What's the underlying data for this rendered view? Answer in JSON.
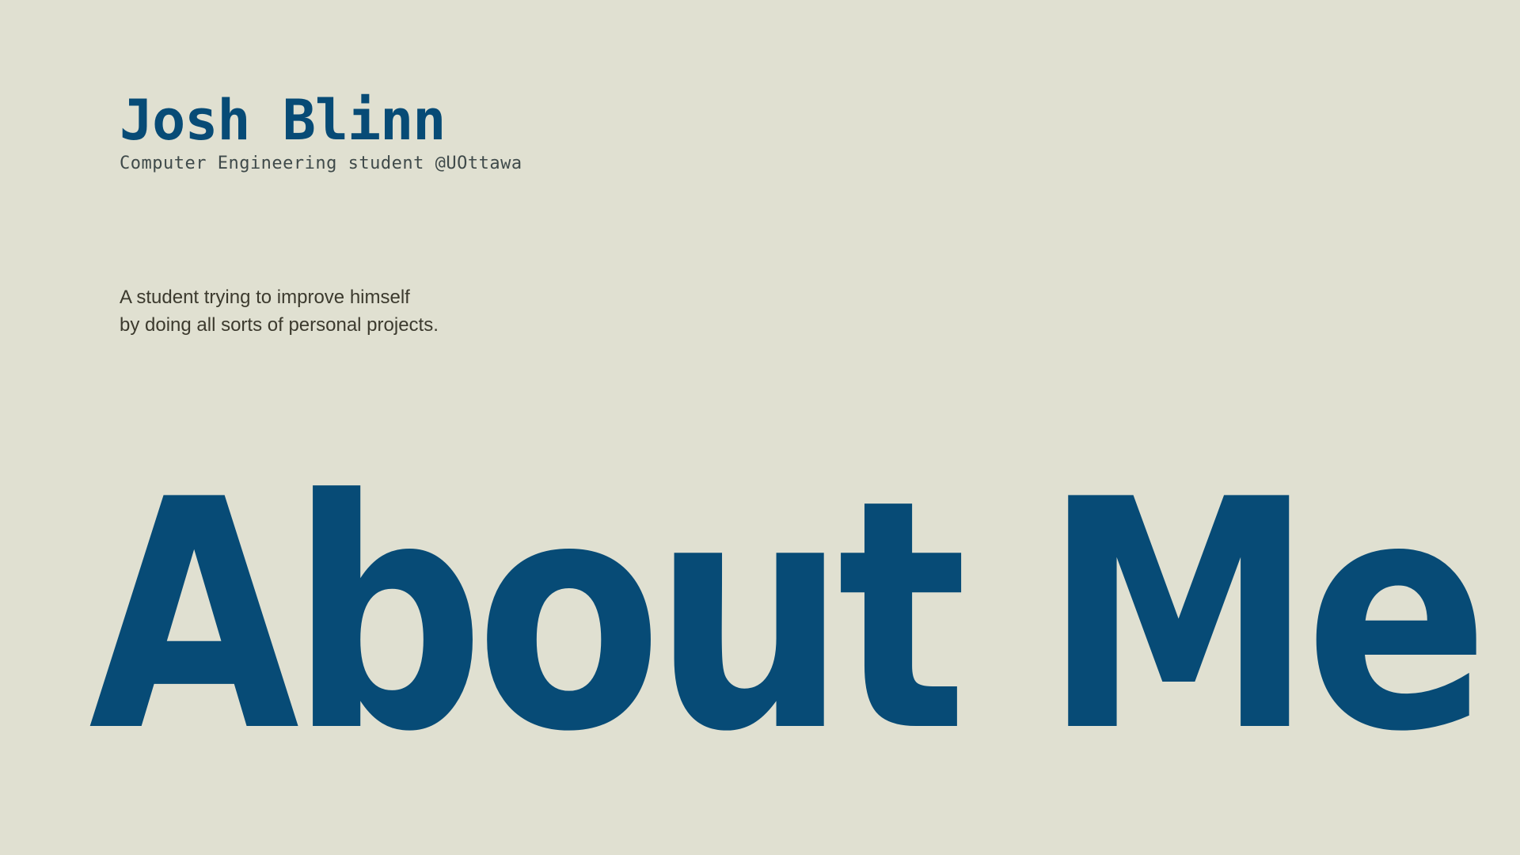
{
  "header": {
    "name": "Josh Blinn",
    "subtitle": "Computer Engineering student @UOttawa"
  },
  "bio": {
    "line1": "A student trying to improve himself",
    "line2": "by doing all sorts of personal projects."
  },
  "hero": {
    "title": "About Me"
  },
  "colors": {
    "background": "#e0e0d1",
    "accent": "#074b76",
    "text": "#3c3a2e"
  }
}
